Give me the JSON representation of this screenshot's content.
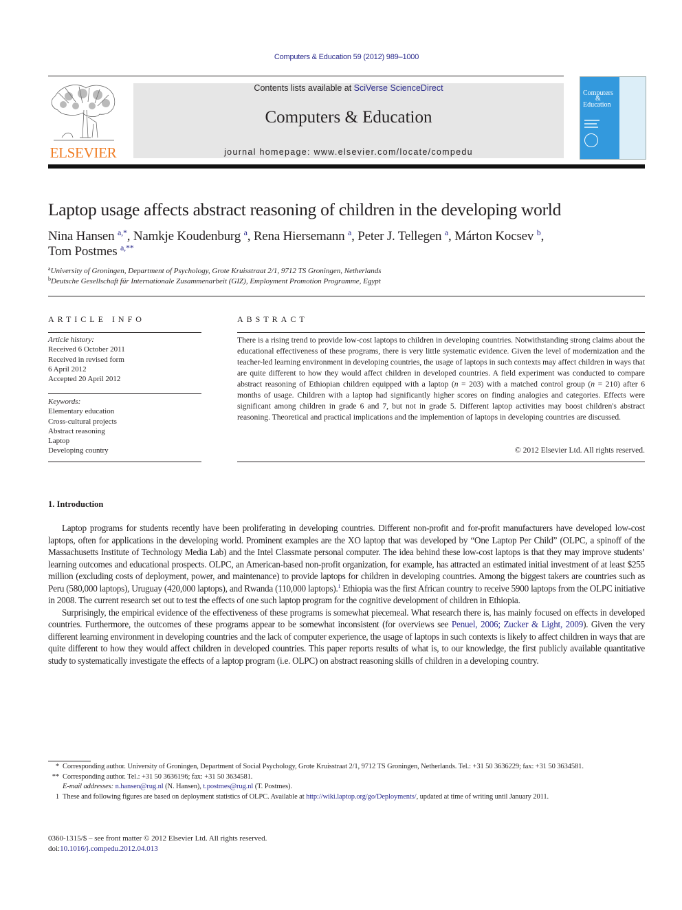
{
  "journal_reference": "Computers & Education 59 (2012) 989–1000",
  "masthead": {
    "contents_prefix": "Contents lists available at ",
    "contents_link": "SciVerse ScienceDirect",
    "journal_title": "Computers & Education",
    "homepage_prefix": "journal homepage: ",
    "homepage_url": "www.elsevier.com/locate/compedu"
  },
  "publisher_logo": {
    "wordmark": "ELSEVIER",
    "color": "#f07c22"
  },
  "cover": {
    "title_line1": "Computers",
    "title_line2": "&",
    "title_line3": "Education",
    "color": "#3399dd"
  },
  "article": {
    "title": "Laptop usage affects abstract reasoning of children in the developing world",
    "authors": [
      {
        "name": "Nina Hansen",
        "marks": "a,*",
        "sep": ", "
      },
      {
        "name": "Namkje Koudenburg",
        "marks": "a",
        "sep": ", "
      },
      {
        "name": "Rena Hiersemann",
        "marks": "a",
        "sep": ", "
      },
      {
        "name": "Peter J. Tellegen",
        "marks": "a",
        "sep": ", "
      },
      {
        "name": "Márton Kocsev",
        "marks": "b",
        "sep": ","
      },
      {
        "name": "Tom Postmes",
        "marks": "a,**",
        "sep": ""
      }
    ],
    "affiliations": [
      {
        "mark": "a",
        "text": "University of Groningen, Department of Psychology, Grote Kruisstraat 2/1, 9712 TS Groningen, Netherlands"
      },
      {
        "mark": "b",
        "text": "Deutsche Gesellschaft für Internationale Zusammenarbeit (GIZ), Employment Promotion Programme, Egypt"
      }
    ]
  },
  "article_info": {
    "heading": "ARTICLE INFO",
    "history_label": "Article history:",
    "history": [
      "Received 6 October 2011",
      "Received in revised form",
      "6 April 2012",
      "Accepted 20 April 2012"
    ],
    "keywords_label": "Keywords:",
    "keywords": [
      "Elementary education",
      "Cross-cultural projects",
      "Abstract reasoning",
      "Laptop",
      "Developing country"
    ]
  },
  "abstract": {
    "heading": "ABSTRACT",
    "part1": "There is a rising trend to provide low-cost laptops to children in developing countries. Notwithstanding strong claims about the educational effectiveness of these programs, there is very little systematic evidence. Given the level of modernization and the teacher-led learning environment in developing countries, the usage of laptops in such contexts may affect children in ways that are quite different to how they would affect children in developed countries. A field experiment was conducted to compare abstract reasoning of Ethiopian children equipped with a laptop (",
    "n_var": "n",
    "part2": " = 203) with a matched control group (",
    "part3": " = 210) after 6 months of usage. Children with a laptop had significantly higher scores on finding analogies and categories. Effects were significant among children in grade 6 and 7, but not in grade 5. Different laptop activities may boost children's abstract reasoning. Theoretical and practical implications and the implemention of laptops in developing countries are discussed.",
    "copyright": "© 2012 Elsevier Ltd. All rights reserved."
  },
  "introduction": {
    "heading": "1.  Introduction",
    "p1_a": "Laptop programs for students recently have been proliferating in developing countries. Different non-profit and for-profit manufacturers have developed low-cost laptops, often for applications in the developing world. Prominent examples are the XO laptop that was developed by “One Laptop Per Child” (OLPC, a spinoff of the Massachusetts Institute of Technology Media Lab) and the Intel Classmate personal computer. The idea behind these low-cost laptops is that they may improve students’ learning outcomes and educational prospects. OLPC, an American-based non-profit organization, for example, has attracted an estimated initial investment of at least $255 million (excluding costs of deployment, power, and maintenance) to provide laptops for children in developing countries. Among the biggest takers are countries such as Peru (580,000 laptops), Uruguay (420,000 laptops), and Rwanda (110,000 laptops).",
    "p1_fn": "1",
    "p1_b": " Ethiopia was the first African country to receive 5900 laptops from the OLPC initiative in 2008. The current research set out to test the effects of one such laptop program for the cognitive development of children in Ethiopia.",
    "p2_a": "Surprisingly, the empirical evidence of the effectiveness of these programs is somewhat piecemeal. What research there is, has mainly focused on effects in developed countries. Furthermore, the outcomes of these programs appear to be somewhat inconsistent (for overviews see ",
    "p2_cite1": "Penuel, 2006",
    "p2_citesep": "; ",
    "p2_cite2": "Zucker & Light, 2009",
    "p2_b": "). Given the very different learning environment in developing countries and the lack of computer experience, the usage of laptops in such contexts is likely to affect children in ways that are quite different to how they would affect children in developed countries. This paper reports results of what is, to our knowledge, the first publicly available quantitative study to systematically investigate the effects of a laptop program (i.e. OLPC) on abstract reasoning skills of children in a developing country."
  },
  "footnotes": {
    "fn1_mark": "*",
    "fn1_text": "Corresponding author. University of Groningen, Department of Social Psychology, Grote Kruisstraat 2/1, 9712 TS Groningen, Netherlands. Tel.: +31 50 3636229; fax: +31 50 3634581.",
    "fn2_mark": "**",
    "fn2_text": "Corresponding author. Tel.: +31 50 3636196; fax: +31 50 3634581.",
    "email_label": "E-mail addresses:",
    "email1": "n.hansen@rug.nl",
    "email1_who": " (N. Hansen), ",
    "email2": "t.postmes@rug.nl",
    "email2_who": " (T. Postmes).",
    "fn3_mark": "1",
    "fn3_text_a": "These and following figures are based on deployment statistics of OLPC. Available at ",
    "fn3_link": "http://wiki.laptop.org/go/Deployments/",
    "fn3_text_b": ", updated at time of writing until January 2011."
  },
  "front_matter": {
    "issn_line": "0360-1315/$ – see front matter © 2012 Elsevier Ltd. All rights reserved.",
    "doi_prefix": "doi:",
    "doi": "10.1016/j.compedu.2012.04.013"
  },
  "colors": {
    "link": "#2a2a8c",
    "text": "#231f20",
    "masthead_bg": "#e6e6e6"
  }
}
